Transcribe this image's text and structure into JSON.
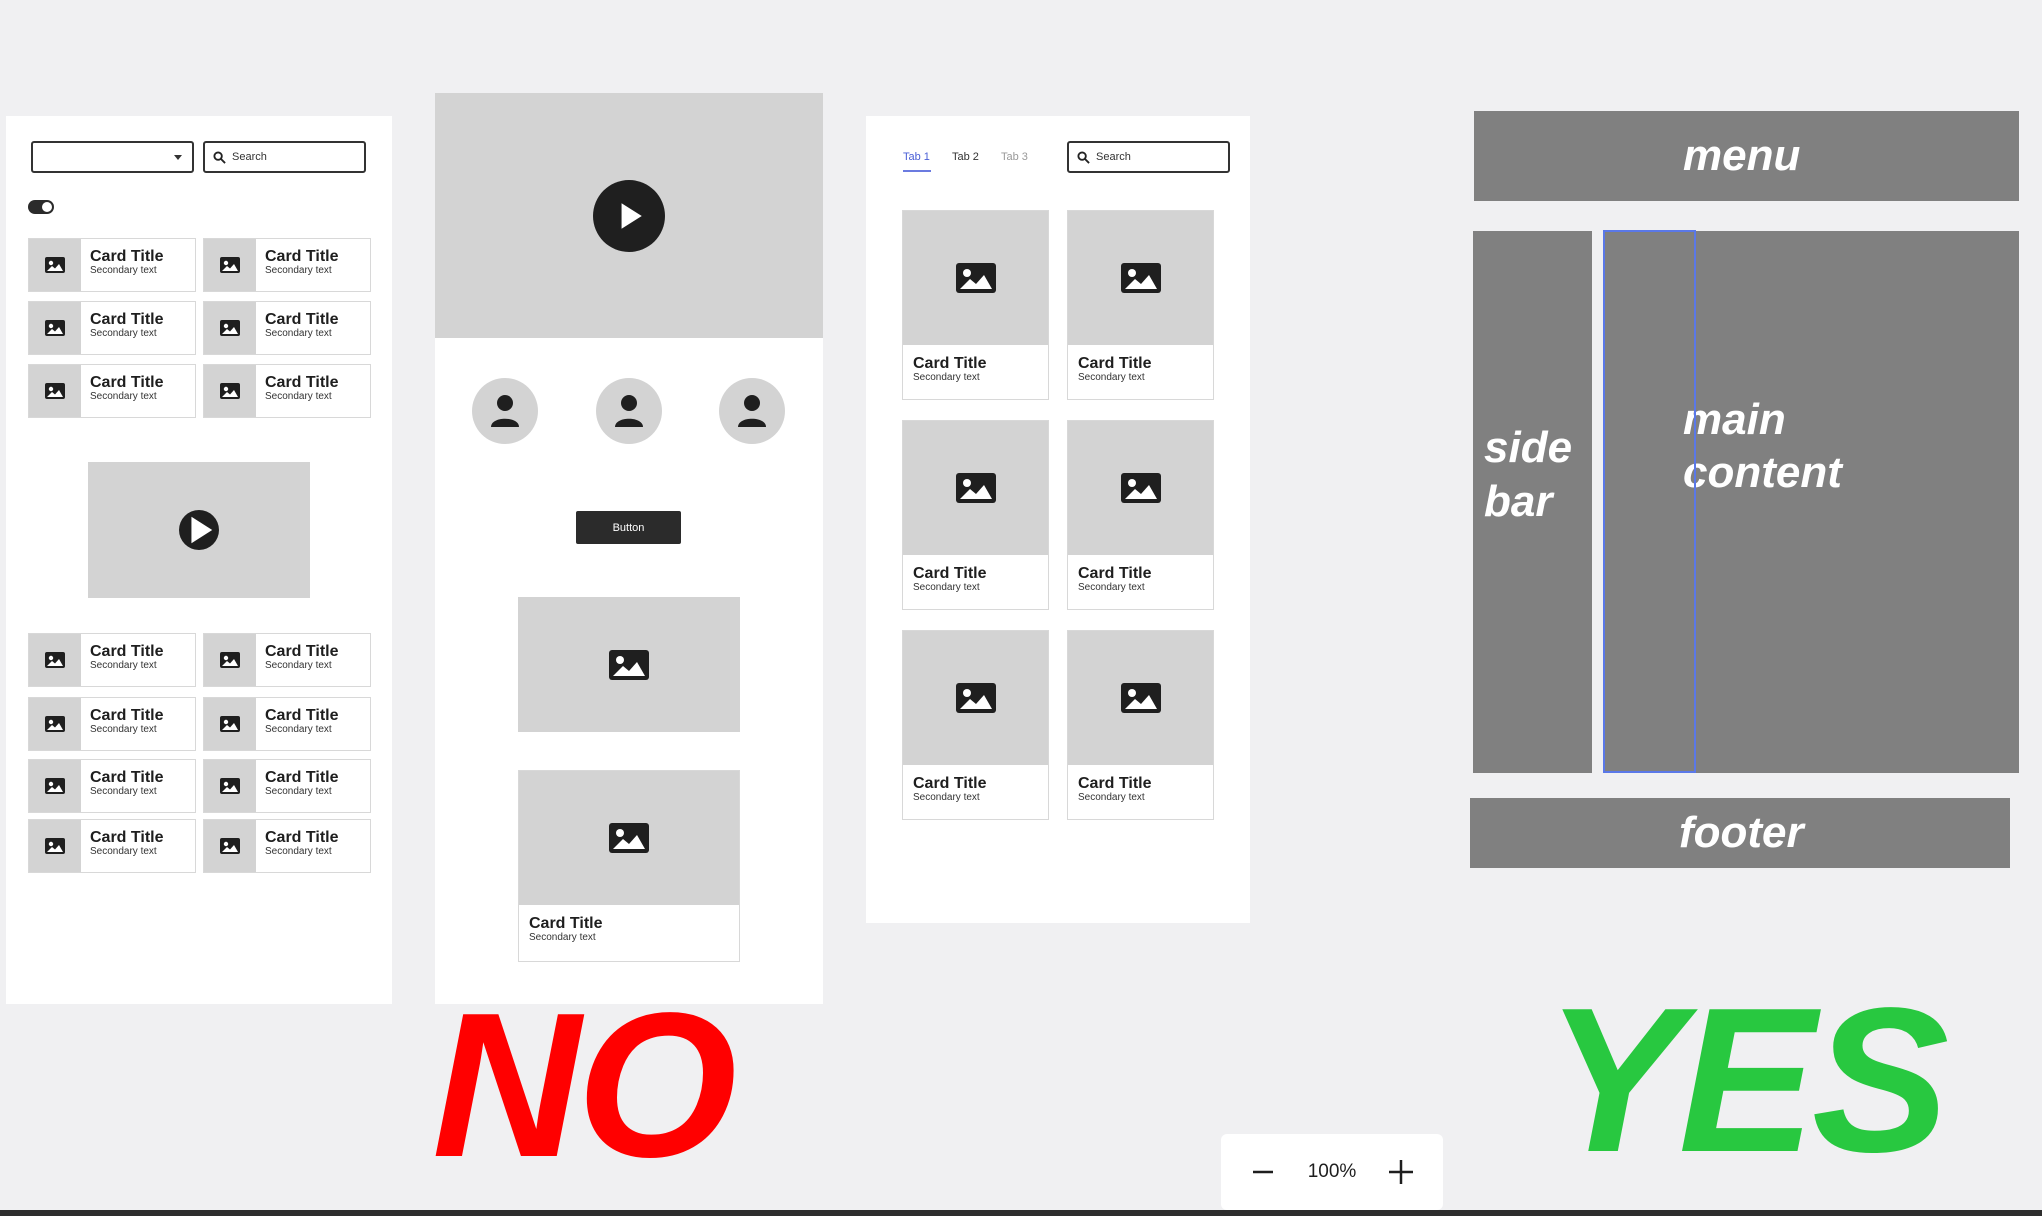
{
  "wireframe_a": {
    "search_placeholder": "Search",
    "cards_top": [
      {
        "title": "Card Title",
        "sub": "Secondary text"
      },
      {
        "title": "Card Title",
        "sub": "Secondary text"
      },
      {
        "title": "Card Title",
        "sub": "Secondary text"
      },
      {
        "title": "Card Title",
        "sub": "Secondary text"
      },
      {
        "title": "Card Title",
        "sub": "Secondary text"
      },
      {
        "title": "Card Title",
        "sub": "Secondary text"
      }
    ],
    "cards_bottom": [
      {
        "title": "Card Title",
        "sub": "Secondary text"
      },
      {
        "title": "Card Title",
        "sub": "Secondary text"
      },
      {
        "title": "Card Title",
        "sub": "Secondary text"
      },
      {
        "title": "Card Title",
        "sub": "Secondary text"
      },
      {
        "title": "Card Title",
        "sub": "Secondary text"
      },
      {
        "title": "Card Title",
        "sub": "Secondary text"
      },
      {
        "title": "Card Title",
        "sub": "Secondary text"
      },
      {
        "title": "Card Title",
        "sub": "Secondary text"
      }
    ]
  },
  "wireframe_b": {
    "button_label": "Button",
    "card": {
      "title": "Card Title",
      "sub": "Secondary text"
    }
  },
  "wireframe_c": {
    "tabs": [
      "Tab 1",
      "Tab 2",
      "Tab 3"
    ],
    "search_placeholder": "Search",
    "cards": [
      {
        "title": "Card Title",
        "sub": "Secondary text"
      },
      {
        "title": "Card Title",
        "sub": "Secondary text"
      },
      {
        "title": "Card Title",
        "sub": "Secondary text"
      },
      {
        "title": "Card Title",
        "sub": "Secondary text"
      },
      {
        "title": "Card Title",
        "sub": "Secondary text"
      },
      {
        "title": "Card Title",
        "sub": "Secondary text"
      }
    ]
  },
  "layout_diagram": {
    "menu": "menu",
    "sidebar_line1": "side",
    "sidebar_line2": "bar",
    "main_line1": "main",
    "main_line2": "content",
    "footer": "footer"
  },
  "verdicts": {
    "no": "NO",
    "yes": "YES",
    "no_color": "#ff0000",
    "yes_color": "#28c840"
  },
  "zoom": {
    "value": "100%",
    "icons": [
      "minus-icon",
      "plus-icon"
    ]
  }
}
